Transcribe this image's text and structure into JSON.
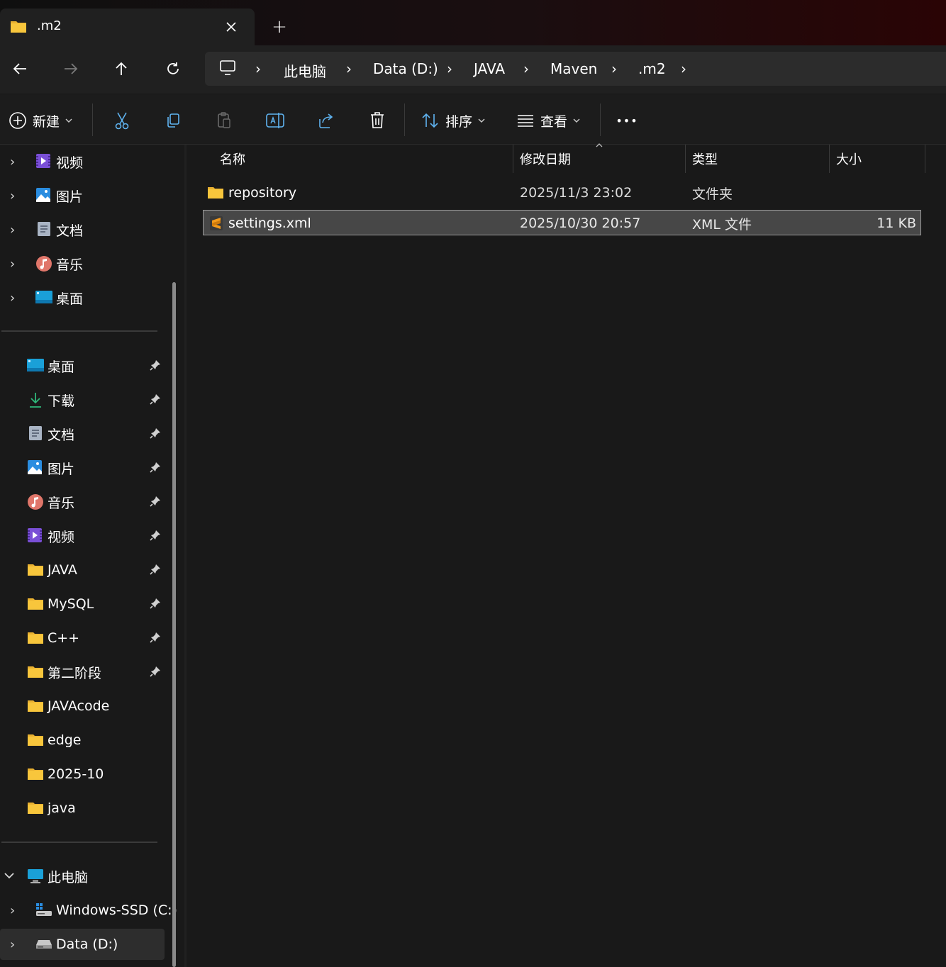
{
  "window": {
    "tab_title": ".m2",
    "close_icon": "close-icon",
    "new_tab_label": "+"
  },
  "navigation": {
    "breadcrumbs": [
      "此电脑",
      "Data (D:)",
      "JAVA",
      "Maven",
      ".m2"
    ],
    "separator": "›"
  },
  "command_bar": {
    "new_label": "新建",
    "sort_label": "排序",
    "view_label": "查看",
    "more_label": "•••"
  },
  "sidebar": {
    "top_items": [
      {
        "label": "视频",
        "icon": "videos-icon"
      },
      {
        "label": "图片",
        "icon": "pictures-icon"
      },
      {
        "label": "文档",
        "icon": "documents-icon"
      },
      {
        "label": "音乐",
        "icon": "music-icon"
      },
      {
        "label": "桌面",
        "icon": "desktop-icon"
      }
    ],
    "quick_access": [
      {
        "label": "桌面",
        "icon": "desktop-icon",
        "pinned": true
      },
      {
        "label": "下载",
        "icon": "download-icon",
        "pinned": true
      },
      {
        "label": "文档",
        "icon": "documents-icon",
        "pinned": true
      },
      {
        "label": "图片",
        "icon": "pictures-icon",
        "pinned": true
      },
      {
        "label": "音乐",
        "icon": "music-icon",
        "pinned": true
      },
      {
        "label": "视频",
        "icon": "videos-icon",
        "pinned": true
      },
      {
        "label": "JAVA",
        "icon": "folder-icon",
        "pinned": true
      },
      {
        "label": "MySQL",
        "icon": "folder-icon",
        "pinned": true
      },
      {
        "label": "C++",
        "icon": "folder-icon",
        "pinned": true
      },
      {
        "label": "第二阶段",
        "icon": "folder-icon",
        "pinned": true
      },
      {
        "label": "JAVAcode",
        "icon": "folder-icon",
        "pinned": false
      },
      {
        "label": "edge",
        "icon": "folder-icon",
        "pinned": false
      },
      {
        "label": "2025-10",
        "icon": "folder-icon",
        "pinned": false
      },
      {
        "label": "java",
        "icon": "folder-icon",
        "pinned": false
      }
    ],
    "this_pc": {
      "label": "此电脑",
      "icon": "computer-icon"
    },
    "drives": [
      {
        "label": "Windows-SSD (C:)",
        "icon": "windows-drive-icon"
      },
      {
        "label": "Data (D:)",
        "icon": "drive-icon"
      }
    ]
  },
  "file_list": {
    "columns": [
      "名称",
      "修改日期",
      "类型",
      "大小"
    ],
    "rows": [
      {
        "name": "repository",
        "modified": "2025/11/3 23:02",
        "type": "文件夹",
        "size": "",
        "icon": "folder-icon"
      },
      {
        "name": "settings.xml",
        "modified": "2025/10/30 20:57",
        "type": "XML 文件",
        "size": "11 KB",
        "icon": "sublime-file-icon",
        "selected": true
      }
    ]
  },
  "colors": {
    "background": "#191919",
    "selected_row": "#474747",
    "folder_yellow": "#f8c63c"
  }
}
